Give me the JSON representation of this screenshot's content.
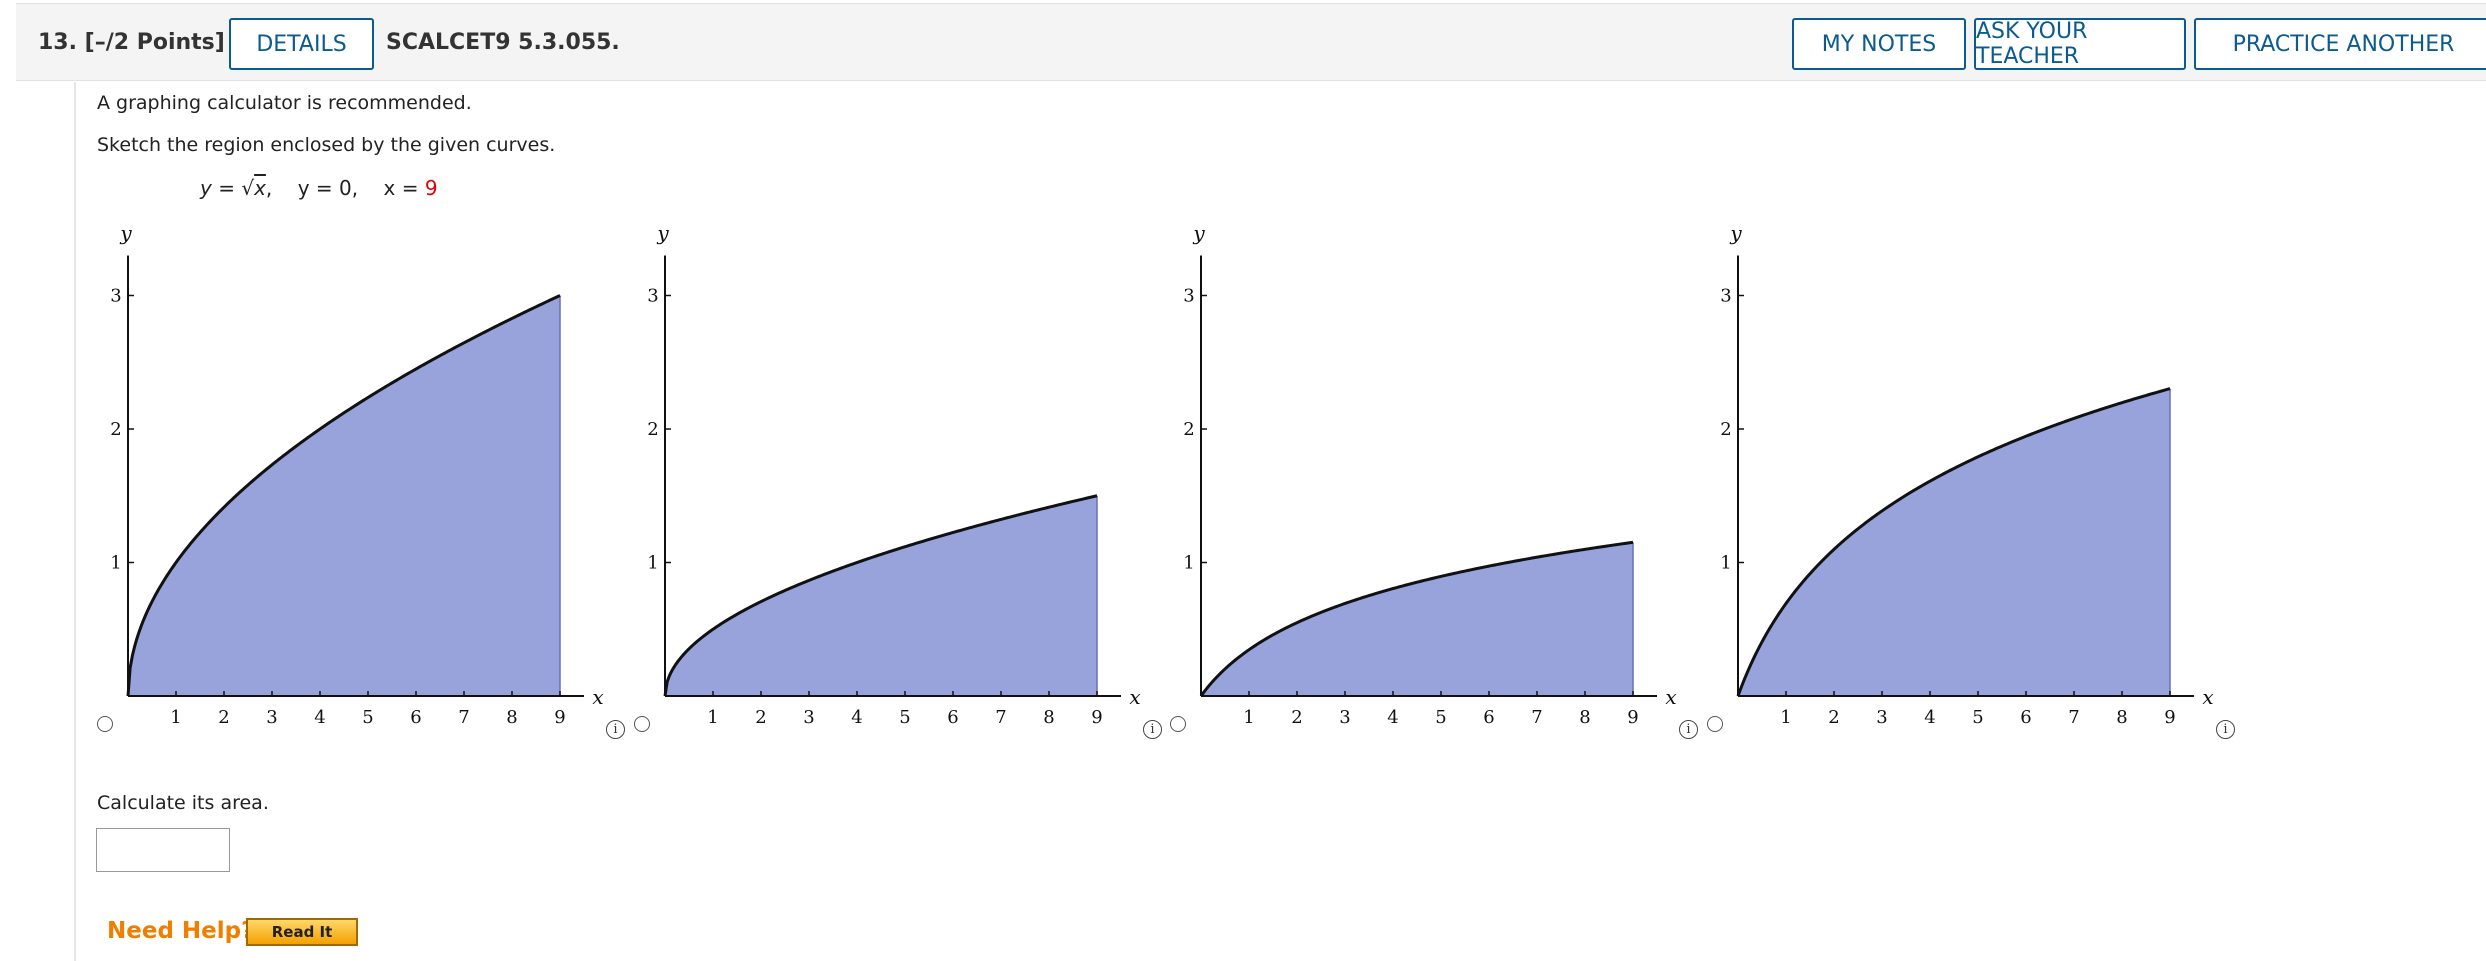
{
  "header": {
    "question_number": "13.",
    "points": "[–/2 Points]",
    "details_label": "DETAILS",
    "source": "SCALCET9 5.3.055.",
    "my_notes_label": "MY NOTES",
    "ask_teacher_label": "ASK YOUR TEACHER",
    "practice_label": "PRACTICE ANOTHER"
  },
  "problem": {
    "calculator_note": "A graphing calculator is recommended.",
    "instruction": "Sketch the region enclosed by the given curves.",
    "curve1_lhs": "y",
    "curve1_eq": " = ",
    "curve1_rad": "x",
    "curve1_sep": ",",
    "curve2": "y = 0,",
    "curve3_lhs": "x = ",
    "curve3_value": "9",
    "area_prompt": "Calculate its area.",
    "answer_value": ""
  },
  "help": {
    "need_help_label": "Need Help?",
    "read_it_label": "Read It"
  },
  "chart_data": [
    {
      "type": "area",
      "function": "sqrt(x)",
      "x_range": [
        0,
        9
      ],
      "ylim": [
        0,
        3.3
      ],
      "xlim": [
        0,
        9.5
      ],
      "xticks": [
        "1",
        "2",
        "3",
        "4",
        "5",
        "6",
        "7",
        "8",
        "9"
      ],
      "yticks": [
        "1",
        "2",
        "3"
      ],
      "xlabel": "x",
      "ylabel": "y",
      "selected": false
    },
    {
      "type": "area",
      "function": "0.5*sqrt(x)",
      "x_range": [
        0,
        9
      ],
      "ylim": [
        0,
        3.3
      ],
      "xlim": [
        0,
        9.5
      ],
      "xticks": [
        "1",
        "2",
        "3",
        "4",
        "5",
        "6",
        "7",
        "8",
        "9"
      ],
      "yticks": [
        "1",
        "2",
        "3"
      ],
      "xlabel": "x",
      "ylabel": "y",
      "selected": false
    },
    {
      "type": "area",
      "function": "ln(x+1)/2",
      "x_range": [
        0,
        9
      ],
      "ylim": [
        0,
        3.3
      ],
      "xlim": [
        0,
        9.5
      ],
      "xticks": [
        "1",
        "2",
        "3",
        "4",
        "5",
        "6",
        "7",
        "8",
        "9"
      ],
      "yticks": [
        "1",
        "2",
        "3"
      ],
      "xlabel": "x",
      "ylabel": "y",
      "selected": false
    },
    {
      "type": "area",
      "function": "ln(x+1)",
      "x_range": [
        0,
        9
      ],
      "ylim": [
        0,
        3.3
      ],
      "xlim": [
        0,
        9.5
      ],
      "xticks": [
        "1",
        "2",
        "3",
        "4",
        "5",
        "6",
        "7",
        "8",
        "9"
      ],
      "yticks": [
        "1",
        "2",
        "3"
      ],
      "xlabel": "x",
      "ylabel": "y",
      "selected": false
    }
  ],
  "colors": {
    "fill": "#98a2db",
    "curve": "#111111",
    "accent": "#0a5b8f",
    "help": "#f07f00",
    "red": "#e00000"
  }
}
